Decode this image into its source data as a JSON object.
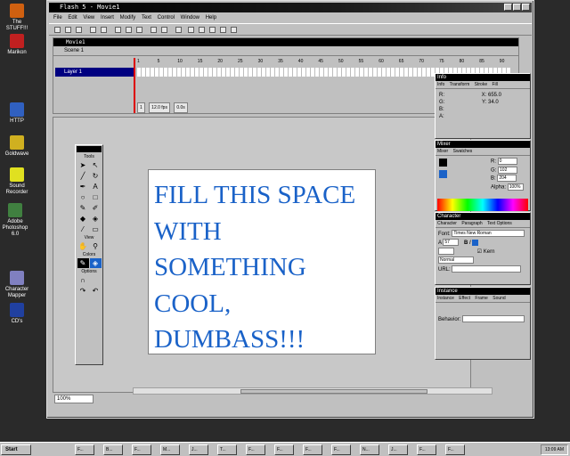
{
  "desktop": {
    "icons": [
      "The STUFF!!!",
      "Marikon",
      "HTTP",
      "Goldwave",
      "Sound Recorder",
      "Adobe Photoshop 6.0",
      "Character Mapper",
      "CD's"
    ]
  },
  "window": {
    "title": "Flash 5 - Movie1",
    "menu": [
      "File",
      "Edit",
      "View",
      "Insert",
      "Modify",
      "Text",
      "Control",
      "Window",
      "Help"
    ]
  },
  "timeline": {
    "title": "Movie1",
    "scene": "Scene 1",
    "frame_numbers": [
      "1",
      "5",
      "10",
      "15",
      "20",
      "25",
      "30",
      "35",
      "40",
      "45",
      "50",
      "55",
      "60",
      "65",
      "70",
      "75",
      "80",
      "85",
      "90"
    ],
    "layer": "Layer 1",
    "status": {
      "frame": "1",
      "fps": "12.0 fps",
      "time": "0.0s"
    }
  },
  "stage": {
    "text": "FILL THIS SPACE WITH SOMETHING COOL, DUMBASS!!!",
    "zoom": "100%"
  },
  "tools_panel": {
    "title": "Tools",
    "sections": [
      "View",
      "Colors",
      "Options"
    ]
  },
  "info_panel": {
    "title": "Info",
    "tabs": [
      "Info",
      "Transform",
      "Stroke",
      "Fill"
    ],
    "readout": {
      "r": "R:",
      "g": "G:",
      "b": "B:",
      "a": "A:",
      "x": "X: 655.0",
      "y": "Y: 34.0"
    }
  },
  "mixer_panel": {
    "title": "Mixer",
    "tabs": [
      "Mixer",
      "Swatches"
    ],
    "r": "R:",
    "r_value": "0",
    "g": "G:",
    "g_value": "102",
    "b": "B:",
    "b_value": "204",
    "alpha": "Alpha:",
    "alpha_value": "100%"
  },
  "character_panel": {
    "title": "Character",
    "tabs": [
      "Character",
      "Paragraph",
      "Text Options"
    ],
    "font_label": "Font:",
    "font": "Times New Roman",
    "size": "57",
    "kern": "Kern",
    "style": "Normal",
    "url": "URL:"
  },
  "instance_panel": {
    "title": "Instance",
    "tabs": [
      "Instance",
      "Effect",
      "Frame",
      "Sound"
    ],
    "behavior": "Behavior:"
  },
  "taskbar": {
    "start": "Start",
    "tasks": [
      "F...",
      "B...",
      "F...",
      "M...",
      "J...",
      "T...",
      "F...",
      "F...",
      "F...",
      "F...",
      "N...",
      "J...",
      "F...",
      "F..."
    ],
    "clock": "13:09 AM"
  },
  "colors": {
    "stage_text": "#1a62c8",
    "timeline_playhead": "#dd0000"
  }
}
